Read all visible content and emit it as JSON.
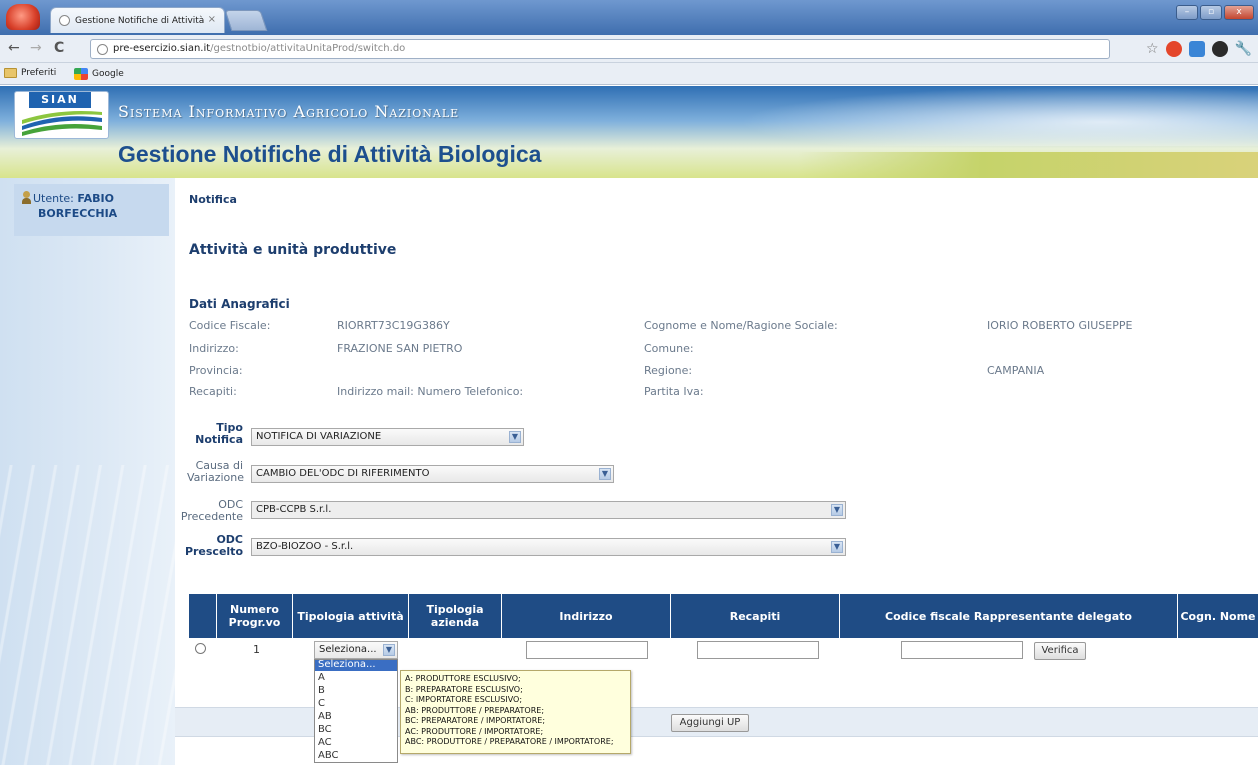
{
  "browser": {
    "tab_title": "Gestione Notifiche di Attività",
    "url_host": "pre-esercizio.sian.it",
    "url_path": "/gestnotbio/attivitaUnitaProd/switch.do",
    "bookmarks": [
      "Preferiti",
      "Google"
    ]
  },
  "header": {
    "logo_text": "SIAN",
    "system_name": "Sistema Informativo Agricolo Nazionale",
    "app_title": "Gestione Notifiche di Attività Biologica"
  },
  "sidebar": {
    "user_label": "Utente:",
    "user_name_first": "FABIO",
    "user_name_last": "BORFECCHIA"
  },
  "main": {
    "breadcrumb": "Notifica",
    "section_title": "Attività e unità produttive",
    "subsection_title": "Dati Anagrafici",
    "anagrafica": {
      "codice_fiscale_label": "Codice Fiscale:",
      "codice_fiscale_value": "RIORRT73C19G386Y",
      "nome_label": "Cognome e Nome/Ragione Sociale:",
      "nome_value": "IORIO ROBERTO GIUSEPPE",
      "indirizzo_label": "Indirizzo:",
      "indirizzo_value": "FRAZIONE SAN PIETRO",
      "comune_label": "Comune:",
      "provincia_label": "Provincia:",
      "regione_label": "Regione:",
      "regione_value": "CAMPANIA",
      "recapiti_label": "Recapiti:",
      "recapiti_value": "Indirizzo mail: Numero Telefonico:",
      "partita_iva_label": "Partita Iva:"
    },
    "form": {
      "tipo_notifica_label": "Tipo Notifica",
      "tipo_notifica_value": "NOTIFICA DI VARIAZIONE",
      "causa_label": "Causa di Variazione",
      "causa_value": "CAMBIO DEL'ODC DI RIFERIMENTO",
      "odc_precedente_label": "ODC Precedente",
      "odc_precedente_value": "CPB-CCPB S.r.l.",
      "odc_prescelto_label": "ODC Prescelto",
      "odc_prescelto_value": "BZO-BIOZOO - S.r.l."
    },
    "table": {
      "headers": [
        "Numero Progr.vo",
        "Tipologia attività",
        "Tipologia azienda",
        "Indirizzo",
        "Recapiti",
        "Codice fiscale Rappresentante delegato",
        "Cogn. Nome"
      ],
      "row_number": "1",
      "select_value": "Seleziona...",
      "verify_button": "Verifica",
      "add_button": "Aggiungi UP"
    },
    "dropdown_options": [
      "Seleziona...",
      "A",
      "B",
      "C",
      "AB",
      "BC",
      "AC",
      "ABC"
    ],
    "tooltip_lines": [
      "A: PRODUTTORE ESCLUSIVO;",
      "B: PREPARATORE ESCLUSIVO;",
      "C: IMPORTATORE ESCLUSIVO;",
      "AB: PRODUTTORE / PREPARATORE;",
      "BC: PREPARATORE / IMPORTATORE;",
      "AC: PRODUTTORE / IMPORTATORE;",
      "ABC: PRODUTTORE / PREPARATORE / IMPORTATORE;"
    ]
  }
}
